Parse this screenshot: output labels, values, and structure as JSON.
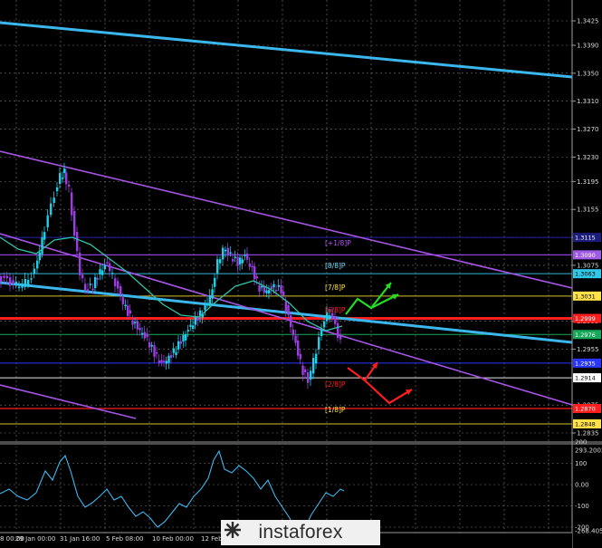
{
  "chart": {
    "price_ticks": [
      "1.3425",
      "1.3390",
      "1.3350",
      "1.3310",
      "1.3270",
      "1.3230",
      "1.3195",
      "1.3155",
      "1.3115",
      "1.3075",
      "1.2995",
      "1.2955",
      "1.2875",
      "1.2835"
    ],
    "level_labels": [
      {
        "text": "[+1/8]P",
        "color": "#b056f5"
      },
      {
        "text": "[8/8]P",
        "color": "#6fdcff"
      },
      {
        "text": "[7/8]P",
        "color": "#ffe24a"
      },
      {
        "text": "[6/8]P",
        "color": "#ff2020"
      },
      {
        "text": "[2/8]P",
        "color": "#ff2020"
      },
      {
        "text": "[1/8]P",
        "color": "#ffe24a"
      }
    ],
    "price_tags": [
      {
        "text": "1.3115",
        "bg": "#1c1c7a",
        "fg": "#ffffff"
      },
      {
        "text": "1.3090",
        "bg": "#a05ae8",
        "fg": "#ffffff"
      },
      {
        "text": "1.3063",
        "bg": "#30c8e8",
        "fg": "#000000"
      },
      {
        "text": "1.3031",
        "bg": "#ffe24a",
        "fg": "#000000"
      },
      {
        "text": "1.2999",
        "bg": "#ff1e1e",
        "fg": "#ffffff"
      },
      {
        "text": "1.2976",
        "bg": "#18a85a",
        "fg": "#ffffff"
      },
      {
        "text": "1.2935",
        "bg": "#2a36ff",
        "fg": "#ffffff"
      },
      {
        "text": "1.2914",
        "bg": "#ffffff",
        "fg": "#000000"
      },
      {
        "text": "1.2870",
        "bg": "#ff1e1e",
        "fg": "#ffffff"
      },
      {
        "text": "1.2848",
        "bg": "#ffe24a",
        "fg": "#000000"
      }
    ],
    "date_labels": [
      "8 00:00",
      "29 Jan 00:00",
      "31 Jan 16:00",
      "5 Feb 08:00",
      "10 Feb 00:00",
      "12 Feb"
    ],
    "indicator_ticks": [
      "293.2002",
      "200",
      "100",
      "0.00",
      "-100",
      "-200",
      "-268.405"
    ]
  },
  "logo": {
    "text": "instaforex"
  },
  "colors": {
    "background": "#000000",
    "grid": "#7a7a7a",
    "channel": "#3cb7ee",
    "trend": "#a654e6",
    "bull_candle": "#1ecfe8",
    "bear_candle": "#9b3de0",
    "ma": "#2ec4a8",
    "arrow_up": "#22dd22",
    "arrow_down": "#ff1e1e"
  }
}
